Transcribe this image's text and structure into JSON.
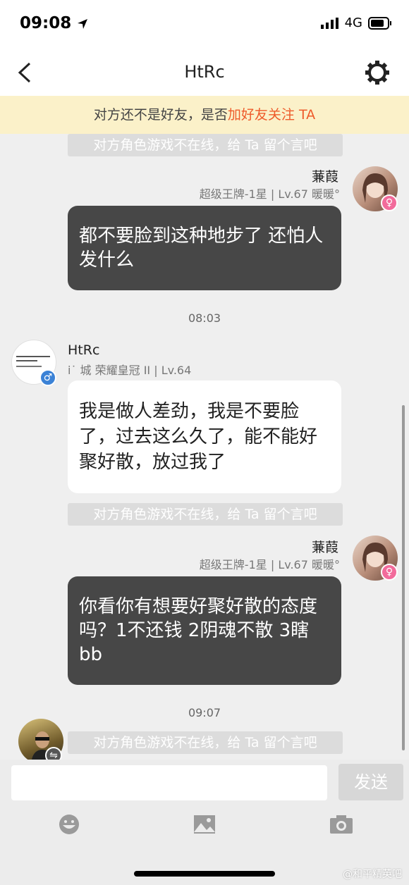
{
  "status_bar": {
    "time": "09:08",
    "network": "4G"
  },
  "header": {
    "title": "HtRc"
  },
  "banner": {
    "prefix": "对方还不是好友，是否",
    "link": "加好友关注 TA"
  },
  "messages": [
    {
      "type": "system",
      "text": "对方角色游戏不在线，给 Ta 留个言吧"
    },
    {
      "type": "outgoing",
      "name": "蒹葭",
      "meta": "超级王牌-1星 | Lv.67 暖暖°",
      "text": "都不要脸到这种地步了 还怕人发什么"
    },
    {
      "type": "time",
      "text": "08:03"
    },
    {
      "type": "incoming",
      "name": "HtRc",
      "meta": "i˙ 城 荣耀皇冠 II | Lv.64",
      "text": "我是做人差劲，我是不要脸了，过去这么久了，能不能好聚好散，放过我了"
    },
    {
      "type": "system",
      "text": "对方角色游戏不在线，给 Ta 留个言吧"
    },
    {
      "type": "outgoing",
      "name": "蒹葭",
      "meta": "超级王牌-1星 | Lv.67 暖暖°",
      "text": "你看你有想要好聚好散的态度吗？1不还钱 2阴魂不散 3瞎 bb"
    },
    {
      "type": "time",
      "text": "09:07"
    },
    {
      "type": "system",
      "text": "对方角色游戏不在线，给 Ta 留个言吧"
    }
  ],
  "input": {
    "send_label": "发送",
    "value": ""
  },
  "toolbar": {
    "icons": [
      "emoji-icon",
      "image-icon",
      "camera-icon"
    ]
  },
  "watermark": "@和平精英吧",
  "colors": {
    "accent": "#ee5a2a",
    "banner_bg": "#fbf1c9",
    "dark_bubble": "#474747",
    "female": "#f26b9b",
    "male": "#3b82d6"
  }
}
